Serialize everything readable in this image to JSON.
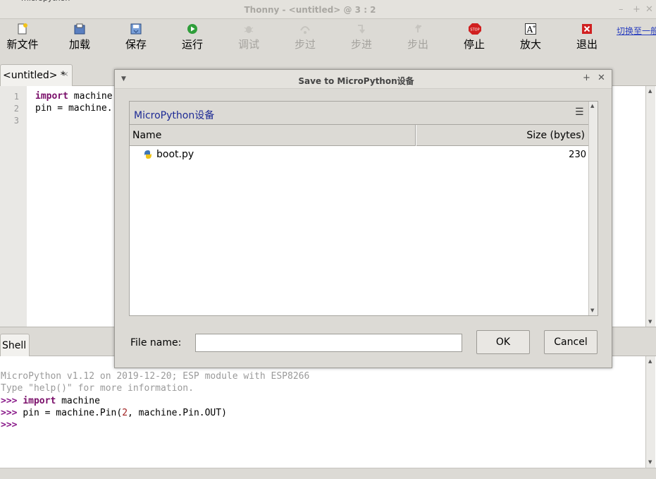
{
  "window": {
    "title": "Thonny  -  <untitled>  @  3 : 2",
    "top_title_fragment": "micropython"
  },
  "toolbar": {
    "items": [
      {
        "label": "新文件",
        "icon": "new-file-icon",
        "enabled": true
      },
      {
        "label": "加载",
        "icon": "load-icon",
        "enabled": true
      },
      {
        "label": "保存",
        "icon": "save-icon",
        "enabled": true
      },
      {
        "label": "运行",
        "icon": "run-icon",
        "enabled": true
      },
      {
        "label": "调试",
        "icon": "debug-icon",
        "enabled": false
      },
      {
        "label": "步过",
        "icon": "step-over-icon",
        "enabled": false
      },
      {
        "label": "步进",
        "icon": "step-into-icon",
        "enabled": false
      },
      {
        "label": "步出",
        "icon": "step-out-icon",
        "enabled": false
      },
      {
        "label": "停止",
        "icon": "stop-icon",
        "enabled": true
      },
      {
        "label": "放大",
        "icon": "zoom-icon",
        "enabled": true
      },
      {
        "label": "退出",
        "icon": "quit-icon",
        "enabled": true
      }
    ],
    "switch_link": "切换至一般"
  },
  "editor": {
    "tab_label": "<untitled> *",
    "tab_close": "×",
    "line_numbers": [
      "1",
      "2",
      "3"
    ],
    "lines": [
      {
        "kw": "import",
        "rest": " machine"
      },
      {
        "kw": "",
        "rest": "pin = machine."
      }
    ]
  },
  "shell": {
    "tab_label": "Shell",
    "banner1": "MicroPython v1.12 on 2019-12-20; ESP module with ESP8266",
    "banner2": "Type \"help()\" for more information.",
    "prompt": ">>>",
    "cmd1_kw": "import",
    "cmd1_rest": " machine",
    "cmd2_a": "pin = machine.Pin(",
    "cmd2_num": "2",
    "cmd2_b": ", machine.Pin.OUT)"
  },
  "dialog": {
    "title": "Save to MicroPython设备",
    "location": "MicroPython设备",
    "columns": {
      "name": "Name",
      "size": "Size (bytes)"
    },
    "files": [
      {
        "name": "boot.py",
        "size": "230"
      }
    ],
    "filename_label": "File name:",
    "filename_value": "",
    "ok_label": "OK",
    "cancel_label": "Cancel"
  },
  "colors": {
    "link": "#2a3fbf",
    "keyword": "#7a0f6a",
    "location": "#1d2a95",
    "run_green": "#2f9e3a",
    "stop_red": "#d02020"
  }
}
